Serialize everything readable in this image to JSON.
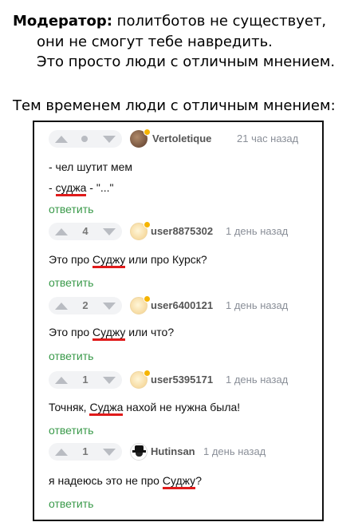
{
  "moderator": {
    "name": "Модератор:",
    "line1": "политботов не существует,",
    "line2": "они не смогут тебе навредить.",
    "line3": "Это просто люди с отличным мнением."
  },
  "intro": "Тем временем люди с отличным мнением:",
  "comments": [
    {
      "author": "Vertoletique",
      "time": "21 час назад",
      "votes": "",
      "line1": "- чел шутит мем",
      "line2_pre": "- ",
      "line2_u": "суджа",
      "line2_post": " - \"...\"",
      "reply": "ответить"
    },
    {
      "author": "user8875302",
      "time": "1 день назад",
      "votes": "4",
      "text_pre": "Это про ",
      "text_u": "Суджу",
      "text_post": " или про Курск?",
      "reply": "ответить"
    },
    {
      "author": "user6400121",
      "time": "1 день назад",
      "votes": "2",
      "text_pre": "Это про ",
      "text_u": "Суджу",
      "text_post": " или что?",
      "reply": "ответить"
    },
    {
      "author": "user5395171",
      "time": "1 день назад",
      "votes": "1",
      "text_pre": "Точняк, ",
      "text_u": "Суджа",
      "text_post": " нахой не нужна была!",
      "reply": "ответить"
    },
    {
      "author": "Hutinsan",
      "time": "1 день назад",
      "votes": "1",
      "text_pre": "я надеюсь это не про ",
      "text_u": "Суджу",
      "text_post": "?",
      "reply": "ответить"
    }
  ],
  "colors": {
    "underline": "#e01b1b",
    "reply": "#3a9a4a",
    "online_dot": "#f5b400"
  },
  "icons": [
    "upvote-arrow-icon",
    "downvote-arrow-icon",
    "online-dot-icon"
  ]
}
